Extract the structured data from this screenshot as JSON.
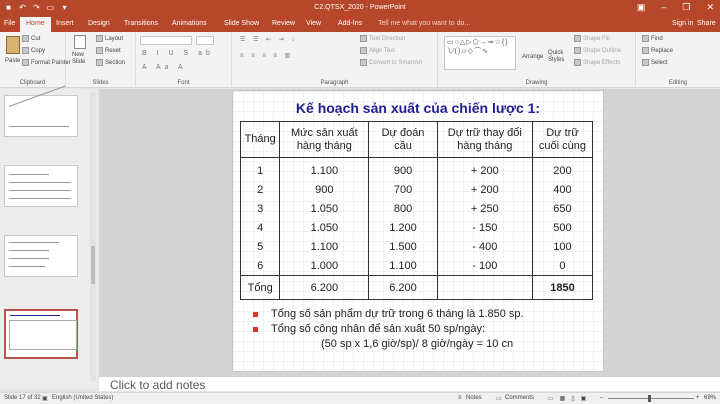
{
  "window": {
    "title": "C2.QTSX_2020 - PowerPoint"
  },
  "tabs": [
    "File",
    "Home",
    "Insert",
    "Design",
    "Transitions",
    "Animations",
    "Slide Show",
    "Review",
    "View",
    "Add-Ins"
  ],
  "tell_me": "Tell me what you want to do...",
  "sign_in": "Sign in",
  "share": "Share",
  "ribbon": {
    "clipboard": {
      "paste": "Paste",
      "cut": "Cut",
      "copy": "Copy",
      "format_painter": "Format Painter",
      "label": "Clipboard"
    },
    "slides": {
      "new_slide": "New Slide",
      "layout": "Layout",
      "reset": "Reset",
      "section": "Section",
      "label": "Slides"
    },
    "font": {
      "label": "Font"
    },
    "paragraph": {
      "text_direction": "Text Direction",
      "align_text": "Align Text",
      "convert_smartart": "Convert to SmartArt",
      "label": "Paragraph"
    },
    "drawing": {
      "arrange": "Arrange",
      "quick_styles": "Quick Styles",
      "shape_fill": "Shape Fill",
      "shape_outline": "Shape Outline",
      "shape_effects": "Shape Effects",
      "label": "Drawing"
    },
    "editing": {
      "find": "Find",
      "replace": "Replace",
      "select": "Select",
      "label": "Editing"
    }
  },
  "slide": {
    "title": "Kế hoạch sản xuất của chiến lược 1:",
    "headers": [
      [
        "Tháng"
      ],
      [
        "Mức sản xuất",
        "hàng tháng"
      ],
      [
        "Dự đoán",
        "cầu"
      ],
      [
        "Dự trữ thay đổi",
        "hàng tháng"
      ],
      [
        "Dự trữ",
        "cuối cùng"
      ]
    ],
    "rows": [
      [
        "1",
        "1.100",
        "900",
        "+ 200",
        "200"
      ],
      [
        "2",
        "900",
        "700",
        "+ 200",
        "400"
      ],
      [
        "3",
        "1.050",
        "800",
        "+ 250",
        "650"
      ],
      [
        "4",
        "1.050",
        "1.200",
        "- 150",
        "500"
      ],
      [
        "5",
        "1.100",
        "1.500",
        "- 400",
        "100"
      ],
      [
        "6",
        "1.000",
        "1.100",
        "- 100",
        "0"
      ]
    ],
    "total": [
      "Tổng",
      "6.200",
      "6.200",
      "",
      "1850"
    ],
    "bullets": [
      "Tổng số sản phẩm dự trữ trong 6 tháng là 1.850 sp.",
      "Tổng số công nhân để sản xuất 50 sp/ngày:",
      "(50 sp x 1,6 giờ/sp)/ 8 giờ/ngày = 10 cn"
    ]
  },
  "notes_placeholder": "Click to add notes",
  "status": {
    "slide_count": "Slide 17 of 32",
    "language": "English (United States)",
    "notes": "Notes",
    "comments": "Comments",
    "zoom": "69%"
  }
}
